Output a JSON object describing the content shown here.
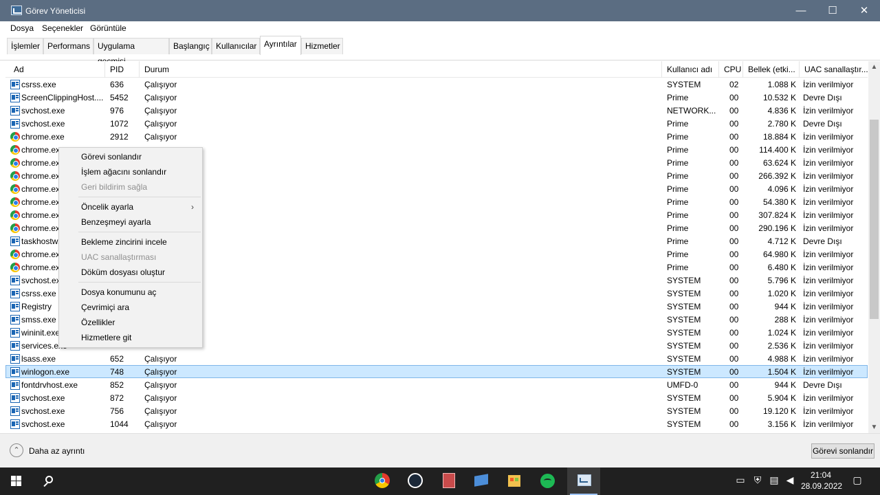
{
  "window": {
    "title": "Görev Yöneticisi",
    "minimize": "—",
    "maximize": "☐",
    "close": "✕"
  },
  "menu": {
    "file": "Dosya",
    "options": "Seçenekler",
    "view": "Görüntüle"
  },
  "tabs": [
    {
      "label": "İşlemler",
      "active": false
    },
    {
      "label": "Performans",
      "active": false
    },
    {
      "label": "Uygulama geçmişi",
      "active": false
    },
    {
      "label": "Başlangıç",
      "active": false
    },
    {
      "label": "Kullanıcılar",
      "active": false
    },
    {
      "label": "Ayrıntılar",
      "active": true
    },
    {
      "label": "Hizmetler",
      "active": false
    }
  ],
  "table": {
    "columns": {
      "name": "Ad",
      "pid": "PID",
      "status": "Durum",
      "user": "Kullanıcı adı",
      "cpu": "CPU",
      "memory": "Bellek (etki...",
      "uac": "UAC sanallaştır..."
    },
    "rows": [
      {
        "name": "csrss.exe",
        "pid": "636",
        "status": "Çalışıyor",
        "user": "SYSTEM",
        "cpu": "02",
        "memory": "1.088 K",
        "uac": "İzin verilmiyor",
        "icon": "generic"
      },
      {
        "name": "ScreenClippingHost....",
        "pid": "5452",
        "status": "Çalışıyor",
        "user": "Prime",
        "cpu": "00",
        "memory": "10.532 K",
        "uac": "Devre Dışı",
        "icon": "generic"
      },
      {
        "name": "svchost.exe",
        "pid": "976",
        "status": "Çalışıyor",
        "user": "NETWORK...",
        "cpu": "00",
        "memory": "4.836 K",
        "uac": "İzin verilmiyor",
        "icon": "generic"
      },
      {
        "name": "svchost.exe",
        "pid": "1072",
        "status": "Çalışıyor",
        "user": "Prime",
        "cpu": "00",
        "memory": "2.780 K",
        "uac": "Devre Dışı",
        "icon": "generic"
      },
      {
        "name": "chrome.exe",
        "pid": "2912",
        "status": "Çalışıyor",
        "user": "Prime",
        "cpu": "00",
        "memory": "18.884 K",
        "uac": "İzin verilmiyor",
        "icon": "chrome"
      },
      {
        "name": "chrome.exe",
        "pid": "",
        "status": "",
        "user": "Prime",
        "cpu": "00",
        "memory": "114.400 K",
        "uac": "İzin verilmiyor",
        "icon": "chrome"
      },
      {
        "name": "chrome.exe",
        "pid": "",
        "status": "",
        "user": "Prime",
        "cpu": "00",
        "memory": "63.624 K",
        "uac": "İzin verilmiyor",
        "icon": "chrome"
      },
      {
        "name": "chrome.exe",
        "pid": "",
        "status": "",
        "user": "Prime",
        "cpu": "00",
        "memory": "266.392 K",
        "uac": "İzin verilmiyor",
        "icon": "chrome"
      },
      {
        "name": "chrome.exe",
        "pid": "",
        "status": "",
        "user": "Prime",
        "cpu": "00",
        "memory": "4.096 K",
        "uac": "İzin verilmiyor",
        "icon": "chrome"
      },
      {
        "name": "chrome.exe",
        "pid": "",
        "status": "",
        "user": "Prime",
        "cpu": "00",
        "memory": "54.380 K",
        "uac": "İzin verilmiyor",
        "icon": "chrome"
      },
      {
        "name": "chrome.exe",
        "pid": "",
        "status": "",
        "user": "Prime",
        "cpu": "00",
        "memory": "307.824 K",
        "uac": "İzin verilmiyor",
        "icon": "chrome"
      },
      {
        "name": "chrome.exe",
        "pid": "",
        "status": "",
        "user": "Prime",
        "cpu": "00",
        "memory": "290.196 K",
        "uac": "İzin verilmiyor",
        "icon": "chrome"
      },
      {
        "name": "taskhostw.exe",
        "pid": "",
        "status": "",
        "user": "Prime",
        "cpu": "00",
        "memory": "4.712 K",
        "uac": "Devre Dışı",
        "icon": "generic"
      },
      {
        "name": "chrome.exe",
        "pid": "",
        "status": "",
        "user": "Prime",
        "cpu": "00",
        "memory": "64.980 K",
        "uac": "İzin verilmiyor",
        "icon": "chrome"
      },
      {
        "name": "chrome.exe",
        "pid": "",
        "status": "",
        "user": "Prime",
        "cpu": "00",
        "memory": "6.480 K",
        "uac": "İzin verilmiyor",
        "icon": "chrome"
      },
      {
        "name": "svchost.exe",
        "pid": "",
        "status": "",
        "user": "SYSTEM",
        "cpu": "00",
        "memory": "5.796 K",
        "uac": "İzin verilmiyor",
        "icon": "generic"
      },
      {
        "name": "csrss.exe",
        "pid": "",
        "status": "",
        "user": "SYSTEM",
        "cpu": "00",
        "memory": "1.020 K",
        "uac": "İzin verilmiyor",
        "icon": "generic"
      },
      {
        "name": "Registry",
        "pid": "",
        "status": "",
        "user": "SYSTEM",
        "cpu": "00",
        "memory": "944 K",
        "uac": "İzin verilmiyor",
        "icon": "generic"
      },
      {
        "name": "smss.exe",
        "pid": "",
        "status": "",
        "user": "SYSTEM",
        "cpu": "00",
        "memory": "288 K",
        "uac": "İzin verilmiyor",
        "icon": "generic"
      },
      {
        "name": "wininit.exe",
        "pid": "",
        "status": "",
        "user": "SYSTEM",
        "cpu": "00",
        "memory": "1.024 K",
        "uac": "İzin verilmiyor",
        "icon": "generic"
      },
      {
        "name": "services.exe",
        "pid": "",
        "status": "",
        "user": "SYSTEM",
        "cpu": "00",
        "memory": "2.536 K",
        "uac": "İzin verilmiyor",
        "icon": "generic"
      },
      {
        "name": "lsass.exe",
        "pid": "652",
        "status": "Çalışıyor",
        "user": "SYSTEM",
        "cpu": "00",
        "memory": "4.988 K",
        "uac": "İzin verilmiyor",
        "icon": "generic"
      },
      {
        "name": "winlogon.exe",
        "pid": "748",
        "status": "Çalışıyor",
        "user": "SYSTEM",
        "cpu": "00",
        "memory": "1.504 K",
        "uac": "İzin verilmiyor",
        "icon": "generic",
        "selected": true
      },
      {
        "name": "fontdrvhost.exe",
        "pid": "852",
        "status": "Çalışıyor",
        "user": "UMFD-0",
        "cpu": "00",
        "memory": "944 K",
        "uac": "Devre Dışı",
        "icon": "generic"
      },
      {
        "name": "svchost.exe",
        "pid": "872",
        "status": "Çalışıyor",
        "user": "SYSTEM",
        "cpu": "00",
        "memory": "5.904 K",
        "uac": "İzin verilmiyor",
        "icon": "generic"
      },
      {
        "name": "svchost.exe",
        "pid": "756",
        "status": "Çalışıyor",
        "user": "SYSTEM",
        "cpu": "00",
        "memory": "19.120 K",
        "uac": "İzin verilmiyor",
        "icon": "generic"
      },
      {
        "name": "svchost.exe",
        "pid": "1044",
        "status": "Çalışıyor",
        "user": "SYSTEM",
        "cpu": "00",
        "memory": "3.156 K",
        "uac": "İzin verilmiyor",
        "icon": "generic"
      }
    ]
  },
  "context_menu": {
    "items": [
      {
        "label": "Görevi sonlandır",
        "enabled": true
      },
      {
        "label": "İşlem ağacını sonlandır",
        "enabled": true
      },
      {
        "label": "Geri bildirim sağla",
        "enabled": false
      },
      {
        "separator": true
      },
      {
        "label": "Öncelik ayarla",
        "enabled": true,
        "submenu": true
      },
      {
        "label": "Benzeşmeyi ayarla",
        "enabled": true
      },
      {
        "separator": true
      },
      {
        "label": "Bekleme zincirini incele",
        "enabled": true
      },
      {
        "label": "UAC sanallaştırması",
        "enabled": false
      },
      {
        "label": "Döküm dosyası oluştur",
        "enabled": true
      },
      {
        "separator": true
      },
      {
        "label": "Dosya konumunu aç",
        "enabled": true
      },
      {
        "label": "Çevrimiçi ara",
        "enabled": true
      },
      {
        "label": "Özellikler",
        "enabled": true
      },
      {
        "label": "Hizmetlere git",
        "enabled": true
      }
    ]
  },
  "bottom": {
    "fewer_details": "Daha az ayrıntı",
    "end_task": "Görevi sonlandır"
  },
  "taskbar": {
    "time": "21:04",
    "date": "28.09.2022",
    "apps": [
      "windows-start-icon",
      "search-icon",
      "chrome-icon",
      "steam-icon",
      "app-icon",
      "folder-icon",
      "store-icon",
      "spotify-icon",
      "task-manager-icon"
    ]
  }
}
